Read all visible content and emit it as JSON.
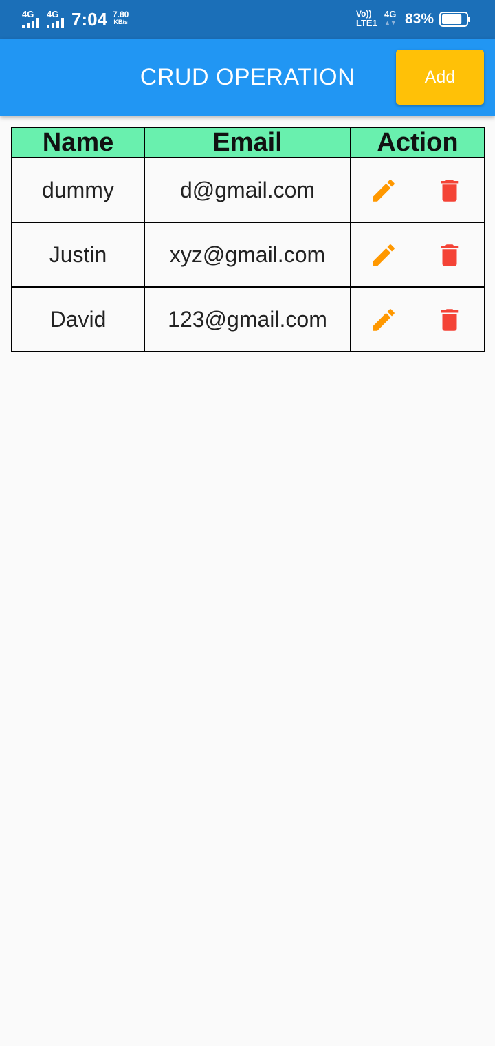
{
  "status_bar": {
    "network1": "4G",
    "network2": "4G",
    "time": "7:04",
    "speed_value": "7.80",
    "speed_unit": "KB/s",
    "volte": "Vo))",
    "lte": "LTE1",
    "network3": "4G",
    "network3_arrows": "▲▼",
    "battery_percent": "83%",
    "battery_level": 0.83
  },
  "app_bar": {
    "title": "CRUD OPERATION",
    "add_label": "Add"
  },
  "table": {
    "headers": [
      "Name",
      "Email",
      "Action"
    ],
    "rows": [
      {
        "name": "dummy",
        "email": "d@gmail.com"
      },
      {
        "name": "Justin",
        "email": "xyz@gmail.com"
      },
      {
        "name": "David",
        "email": "123@gmail.com"
      }
    ]
  },
  "icons": {
    "edit": "pencil-icon",
    "delete": "trash-icon"
  },
  "colors": {
    "status_bar": "#1b6fb8",
    "app_bar": "#2196f3",
    "add_button": "#ffc107",
    "header_row": "#69f0ae",
    "edit_icon": "#ff9800",
    "delete_icon": "#f44336",
    "background": "#fafafa"
  }
}
